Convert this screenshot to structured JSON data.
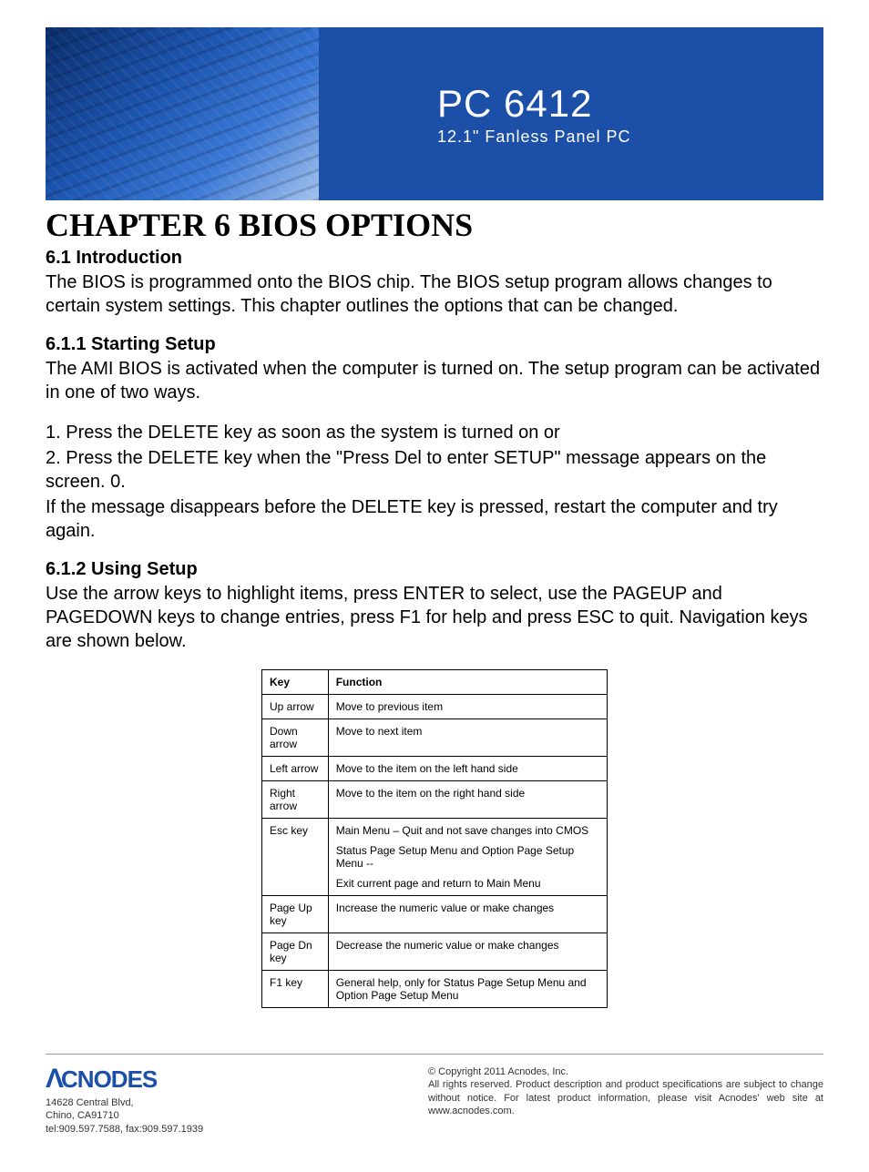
{
  "banner": {
    "title": "PC 6412",
    "subtitle": "12.1\" Fanless Panel PC"
  },
  "chapter": {
    "title": "CHAPTER 6 BIOS OPTIONS"
  },
  "intro": {
    "heading": "6.1 Introduction",
    "text": "The BIOS is programmed onto the BIOS chip. The BIOS setup program allows changes to certain system settings. This chapter outlines the options that can be changed."
  },
  "starting": {
    "heading": "6.1.1 Starting Setup",
    "text1": "The AMI BIOS is activated when the computer is turned on. The setup program can be activated in one of two ways.",
    "item1": "1.   Press the DELETE key as soon as the system is turned on or",
    "item2": "2.   Press the DELETE key when the \"Press Del to enter SETUP\" message appears on the screen. 0.",
    "text2": "If the message disappears before the DELETE key is pressed, restart the computer and try again."
  },
  "using": {
    "heading": "6.1.2 Using Setup",
    "text": "Use the arrow keys to highlight items, press ENTER  to select, use the PAGEUP  and PAGEDOWN keys to change entries, press F1 for help and press ESC to quit. Navigation keys are shown below."
  },
  "table": {
    "headers": {
      "key": "Key",
      "function": "Function"
    },
    "rows": [
      {
        "key": "Up arrow",
        "func": "Move to previous item"
      },
      {
        "key": "Down arrow",
        "func": "Move to next item"
      },
      {
        "key": "Left arrow",
        "func": "Move to the item on the left hand side"
      },
      {
        "key": "Right arrow",
        "func": "Move to the item on the right hand side"
      },
      {
        "key": "Esc key",
        "func1": "Main Menu – Quit and not save changes into CMOS",
        "func2": "Status Page Setup Menu and Option Page Setup Menu --",
        "func3": "Exit current page and return to Main Menu"
      },
      {
        "key": "Page Up key",
        "func": "Increase the numeric value or make changes"
      },
      {
        "key": "Page Dn key",
        "func": "Decrease the numeric value or make changes"
      },
      {
        "key": "F1 key",
        "func": "General help, only for Status Page Setup Menu and Option Page Setup Menu"
      }
    ]
  },
  "footer": {
    "logo": "CNODES",
    "addr1": "14628 Central Blvd,",
    "addr2": "Chino, CA91710",
    "addr3": "tel:909.597.7588, fax:909.597.1939",
    "copyright": "© Copyright 2011 Acnodes, Inc.",
    "rights": "All rights reserved. Product description and product specifications are subject to change without notice. For latest product information, please visit Acnodes' web site at www.acnodes.com."
  }
}
